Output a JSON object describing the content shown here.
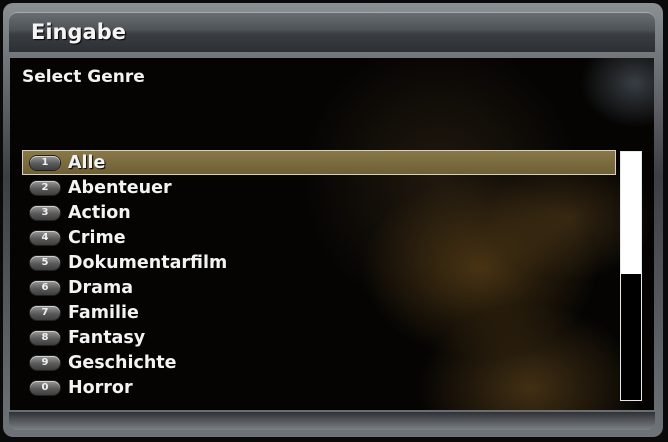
{
  "window": {
    "title": "Eingabe"
  },
  "prompt": {
    "label": "Select Genre"
  },
  "genres": [
    {
      "key": "1",
      "label": "Alle",
      "selected": true
    },
    {
      "key": "2",
      "label": "Abenteuer"
    },
    {
      "key": "3",
      "label": "Action"
    },
    {
      "key": "4",
      "label": "Crime"
    },
    {
      "key": "5",
      "label": "Dokumentarfilm"
    },
    {
      "key": "6",
      "label": "Drama"
    },
    {
      "key": "7",
      "label": "Familie"
    },
    {
      "key": "8",
      "label": "Fantasy"
    },
    {
      "key": "9",
      "label": "Geschichte"
    },
    {
      "key": "0",
      "label": "Horror"
    }
  ],
  "scroll": {
    "visible_fraction": 0.49,
    "position": 0
  },
  "colors": {
    "selection": "#7a6b3f",
    "selection_border": "#d8d2bc",
    "text": "#f3f3f3"
  }
}
